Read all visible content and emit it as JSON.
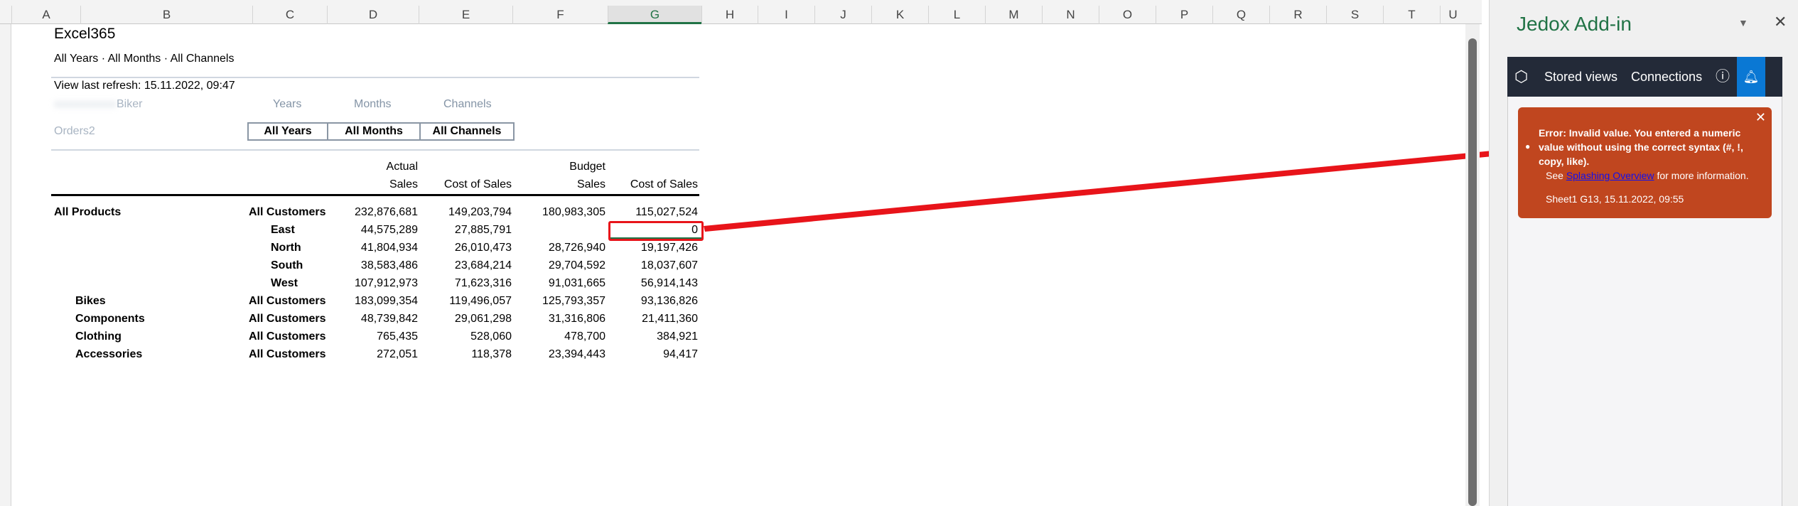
{
  "columns": [
    "A",
    "B",
    "C",
    "D",
    "E",
    "F",
    "G",
    "H",
    "I",
    "J",
    "K",
    "L",
    "M",
    "N",
    "O",
    "P",
    "Q",
    "R",
    "S",
    "T",
    "U"
  ],
  "sheet": {
    "title": "Excel365",
    "subtitle": "All Years · All Months · All Channels",
    "refresh": "View last refresh: 15.11.2022, 09:47",
    "database": "Biker",
    "cube": "Orders2",
    "dims": [
      "Years",
      "Months",
      "Channels"
    ],
    "slicers": [
      "All Years",
      "All Months",
      "All Channels"
    ],
    "header_top": [
      "Actual",
      "Budget"
    ],
    "header_measures": [
      "Sales",
      "Cost of Sales",
      "Sales",
      "Cost of Sales"
    ],
    "rows": [
      {
        "product": "All Products",
        "customer": "All Customers",
        "values": [
          "232,876,681",
          "149,203,794",
          "180,983,305",
          "115,027,524"
        ]
      },
      {
        "product": "",
        "customer": "East",
        "values": [
          "44,575,289",
          "27,885,791",
          "",
          "0"
        ]
      },
      {
        "product": "",
        "customer": "North",
        "values": [
          "41,804,934",
          "26,010,473",
          "28,726,940",
          "19,197,426"
        ]
      },
      {
        "product": "",
        "customer": "South",
        "values": [
          "38,583,486",
          "23,684,214",
          "29,704,592",
          "18,037,607"
        ]
      },
      {
        "product": "",
        "customer": "West",
        "values": [
          "107,912,973",
          "71,623,316",
          "91,031,665",
          "56,914,143"
        ]
      },
      {
        "product": "Bikes",
        "customer": "All Customers",
        "values": [
          "183,099,354",
          "119,496,057",
          "125,793,357",
          "93,136,826"
        ]
      },
      {
        "product": "Components",
        "customer": "All Customers",
        "values": [
          "48,739,842",
          "29,061,298",
          "31,316,806",
          "21,411,360"
        ]
      },
      {
        "product": "Clothing",
        "customer": "All Customers",
        "values": [
          "765,435",
          "528,060",
          "478,700",
          "384,921"
        ]
      },
      {
        "product": "Accessories",
        "customer": "All Customers",
        "values": [
          "272,051",
          "118,378",
          "23,394,443",
          "94,417"
        ]
      }
    ]
  },
  "panel": {
    "title": "Jedox Add-in",
    "nav": {
      "stored_views": "Stored views",
      "connections": "Connections"
    },
    "error": {
      "message": "Error: Invalid value. You entered a numeric value without using the correct syntax (#, !, copy, like).",
      "see": "See",
      "link": "Splashing Overview",
      "after_link": "for more information.",
      "meta": "Sheet1 G13, 15.11.2022, 09:55"
    }
  },
  "colors": {
    "accent": "#217346",
    "error": "#c0461f",
    "nav": "#232a38",
    "bell": "#0a78d4",
    "arrow": "#e8141a"
  }
}
